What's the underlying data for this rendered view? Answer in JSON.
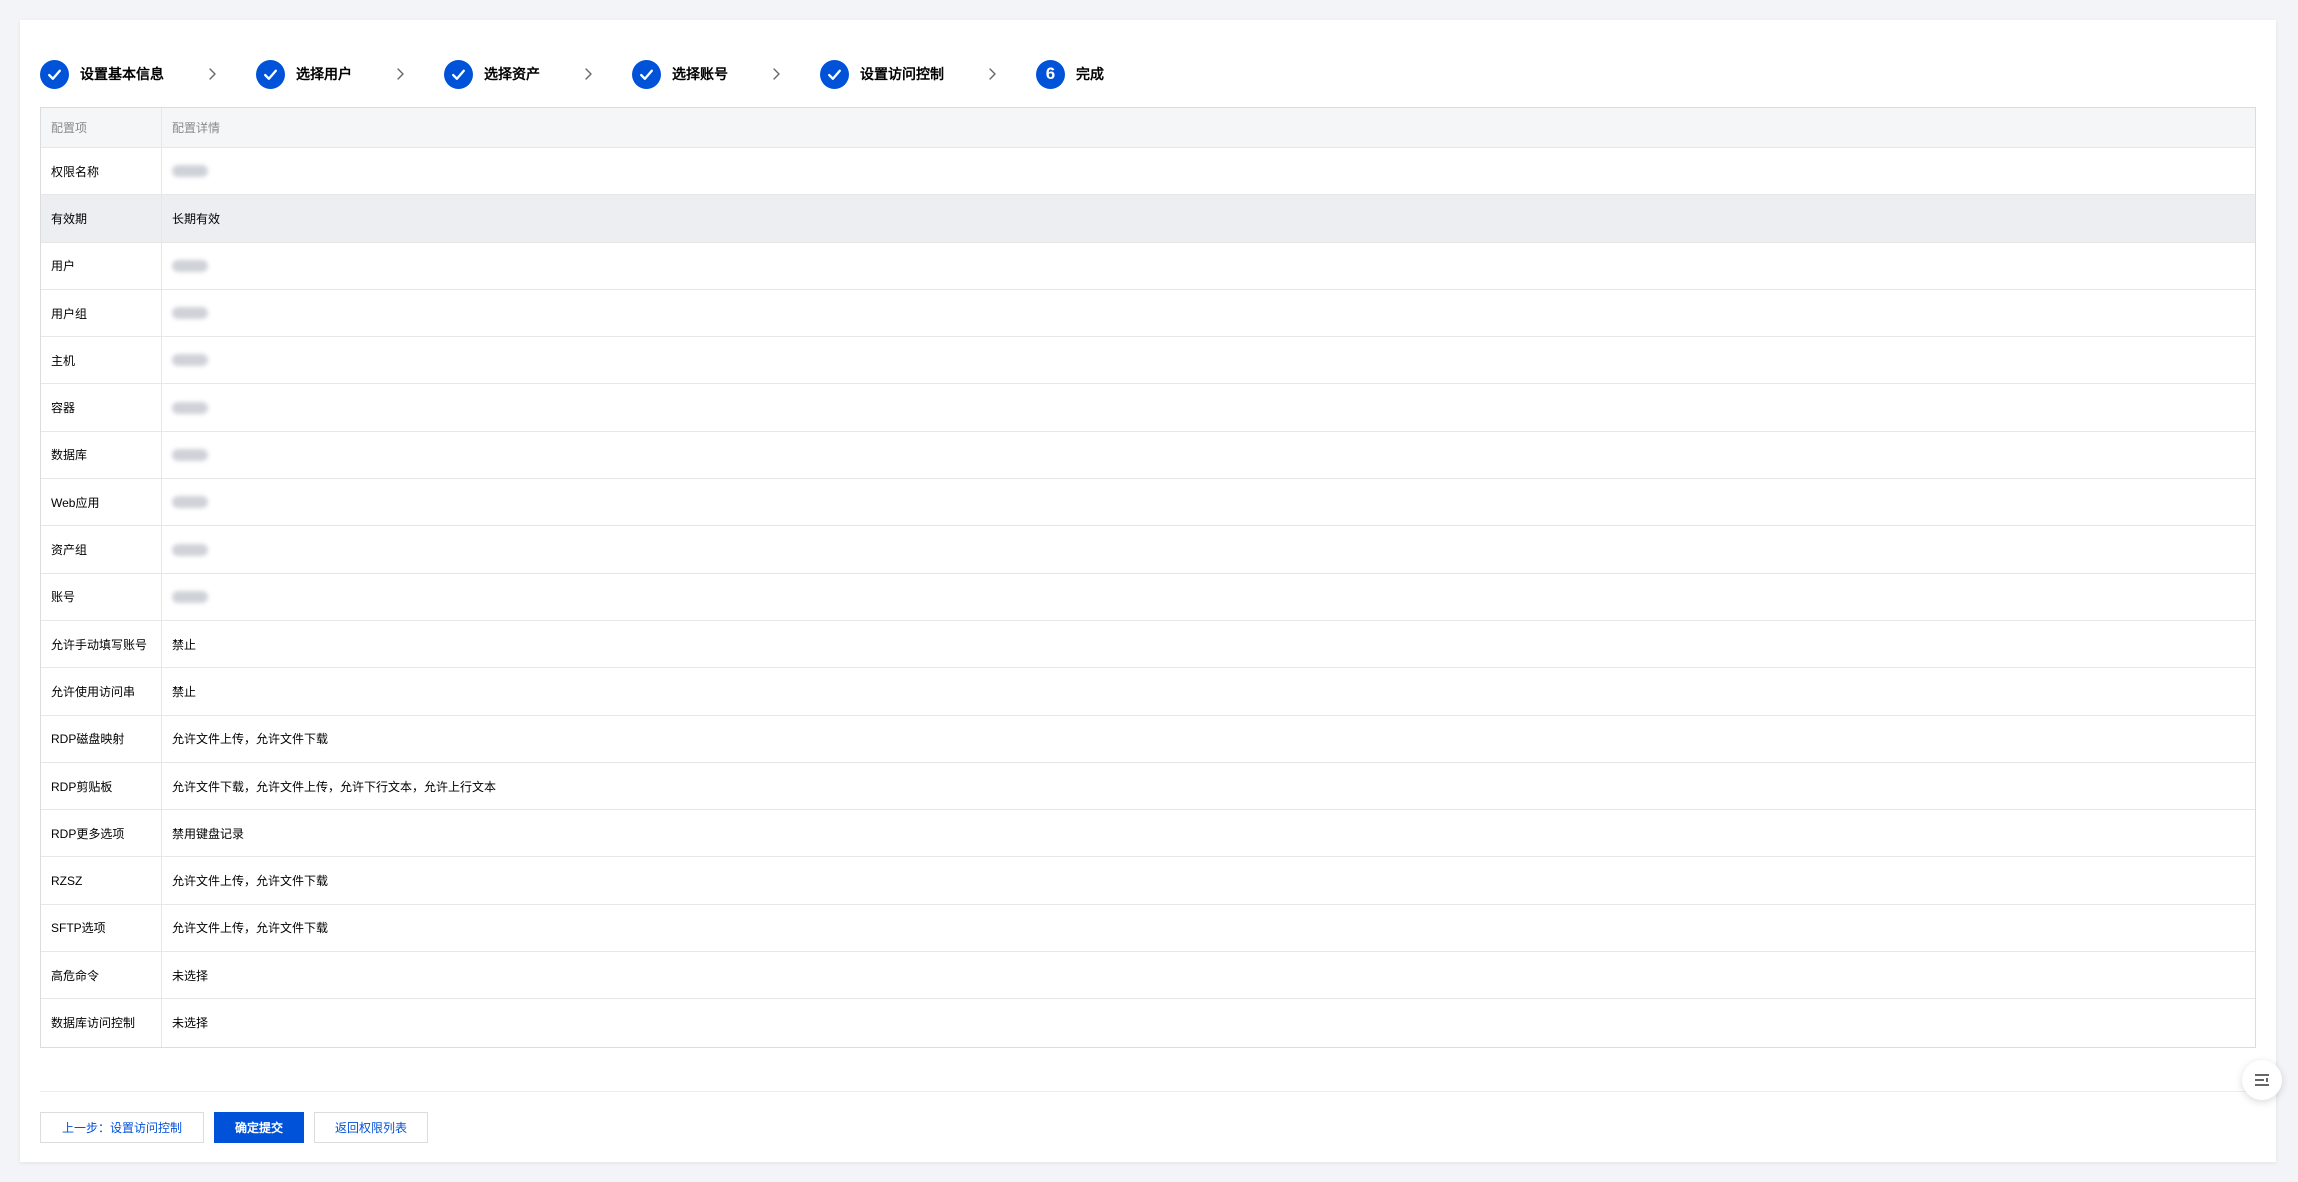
{
  "steps": [
    {
      "label": "设置基本信息",
      "status": "done"
    },
    {
      "label": "选择用户",
      "status": "done"
    },
    {
      "label": "选择资产",
      "status": "done"
    },
    {
      "label": "选择账号",
      "status": "done"
    },
    {
      "label": "设置访问控制",
      "status": "done"
    },
    {
      "label": "完成",
      "status": "current",
      "number": "6"
    }
  ],
  "table": {
    "headers": {
      "key": "配置项",
      "value": "配置详情"
    },
    "rows": [
      {
        "key": "权限名称",
        "value": "",
        "blurred": true
      },
      {
        "key": "有效期",
        "value": "长期有效",
        "highlight": true
      },
      {
        "key": "用户",
        "value": "",
        "blurred": true
      },
      {
        "key": "用户组",
        "value": "",
        "blurred": true
      },
      {
        "key": "主机",
        "value": "",
        "blurred": true
      },
      {
        "key": "容器",
        "value": "",
        "blurred": true
      },
      {
        "key": "数据库",
        "value": "",
        "blurred": true
      },
      {
        "key": "Web应用",
        "value": "",
        "blurred": true
      },
      {
        "key": "资产组",
        "value": "",
        "blurred": true
      },
      {
        "key": "账号",
        "value": "",
        "blurred": true
      },
      {
        "key": "允许手动填写账号",
        "value": "禁止"
      },
      {
        "key": "允许使用访问串",
        "value": "禁止"
      },
      {
        "key": "RDP磁盘映射",
        "value": "允许文件上传，允许文件下载"
      },
      {
        "key": "RDP剪贴板",
        "value": "允许文件下载，允许文件上传，允许下行文本，允许上行文本"
      },
      {
        "key": "RDP更多选项",
        "value": "禁用键盘记录"
      },
      {
        "key": "RZSZ",
        "value": "允许文件上传，允许文件下载"
      },
      {
        "key": "SFTP选项",
        "value": "允许文件上传，允许文件下载"
      },
      {
        "key": "高危命令",
        "value": "未选择"
      },
      {
        "key": "数据库访问控制",
        "value": "未选择"
      }
    ]
  },
  "actions": {
    "prev_label": "上一步：设置访问控制",
    "submit_label": "确定提交",
    "back_label": "返回权限列表"
  },
  "colors": {
    "accent": "#0052d9"
  },
  "icons": {
    "done": "check-icon",
    "separator": "chevron-right-icon",
    "float": "list-settings-icon"
  }
}
